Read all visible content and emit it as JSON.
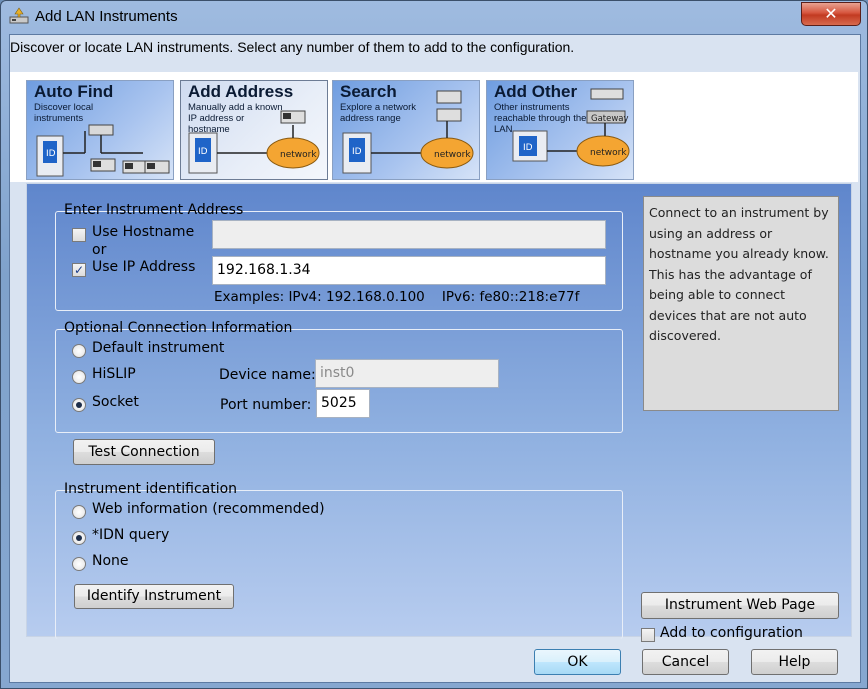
{
  "window": {
    "title": "Add LAN Instruments",
    "close_glyph": "✕"
  },
  "description": "Discover or locate LAN instruments. Select any number of them to add to the configuration.",
  "tabs": [
    {
      "name": "Auto Find",
      "sub": "Discover local instruments",
      "selected": false
    },
    {
      "name": "Add Address",
      "sub": "Manually add a known IP address or hostname",
      "graphic": "network",
      "selected": true
    },
    {
      "name": "Search",
      "sub": "Explore a network address range",
      "graphic": "network",
      "selected": false
    },
    {
      "name": "Add Other",
      "sub": "Other instruments reachable through the LAN",
      "graphic": "network",
      "gateway": "Gateway",
      "selected": false
    }
  ],
  "address_group": {
    "label": "Enter Instrument Address",
    "use_hostname": "Use Hostname",
    "or": "or",
    "use_ip": "Use IP Address",
    "hostname_value": "",
    "ip_value": "192.168.1.34",
    "examples": "Examples: IPv4: 192.168.0.100    IPv6: fe80::218:e77f"
  },
  "connection_group": {
    "label": "Optional Connection Information",
    "options": [
      "Default instrument",
      "HiSLIP",
      "Socket"
    ],
    "selected": "Socket",
    "device_name_label": "Device name:",
    "device_name_value": "inst0",
    "port_label": "Port number:",
    "port_value": "5025"
  },
  "test_button": "Test Connection",
  "identification_group": {
    "label": "Instrument identification",
    "options": [
      "Web information (recommended)",
      "*IDN query",
      "None"
    ],
    "selected": "*IDN query",
    "identify_button": "Identify Instrument"
  },
  "info_text": "Connect to an instrument by using an address or hostname you already know. This has the advantage of being able to connect devices that are not auto discovered.",
  "web_page_button": "Instrument Web Page",
  "add_to_config": {
    "label": "Add to configuration",
    "checked": false
  },
  "footer": {
    "ok": "OK",
    "cancel": "Cancel",
    "help": "Help"
  },
  "colors": {
    "network_cloud": "#f4a532",
    "id_badge": "#1f64c8",
    "accent": "#5f86cc"
  }
}
